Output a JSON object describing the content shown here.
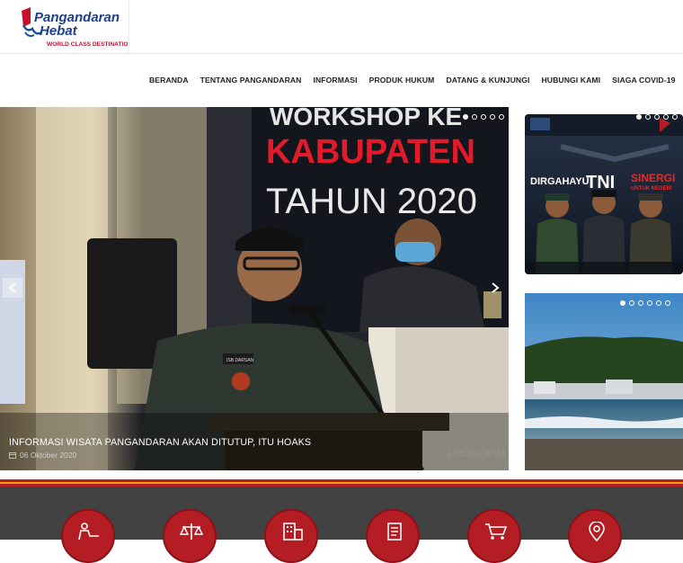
{
  "logo": {
    "line1": "Pangandaran",
    "line2": "Hebat",
    "tagline": "WORLD CLASS DESTINATION"
  },
  "nav": {
    "items": [
      "BERANDA",
      "TENTANG PANGANDARAN",
      "INFORMASI",
      "PRODUK HUKUM",
      "DATANG & KUNJUNGI",
      "HUBUNGI KAMI",
      "SIAGA COVID-19"
    ]
  },
  "slider": {
    "banner_line1": "WORKSHOP KE",
    "banner_line2": "KABUPATEN",
    "banner_line3": "TAHUN 2020",
    "caption_title": "INFORMASI WISATA PANGANDARAN AKAN DITUTUP, ITU HOAKS",
    "caption_date": "06 Oktober 2020",
    "watermark": "PROKOPIM",
    "nameplate": "ISB DARSAN",
    "dots": 5,
    "active_dot": 0
  },
  "side_banner1": {
    "title_left": "DIRGAHAYU",
    "title_mid": "TNI",
    "title_right": "SINERGI",
    "title_right_sub": "UNTUK NEGERI",
    "dots": 5,
    "active_dot": 0
  },
  "side_banner2": {
    "dots": 6,
    "active_dot": 0
  },
  "services": {
    "icons": [
      "person-desk-icon",
      "scales-icon",
      "building-icon",
      "document-icon",
      "cart-icon",
      "location-pin-icon"
    ]
  },
  "colors": {
    "brand_red": "#b41d24",
    "nav_text": "#222222",
    "footer_bg": "#424242",
    "stripe_orange": "#e8a21a"
  }
}
